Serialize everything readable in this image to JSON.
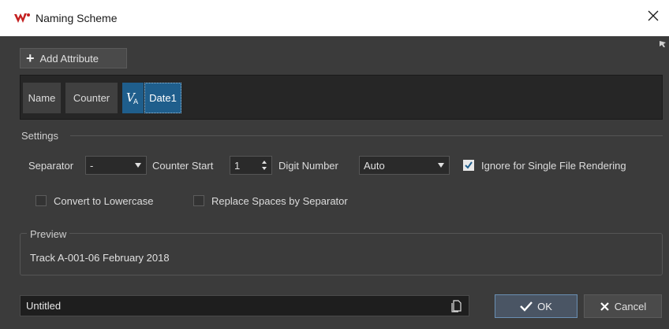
{
  "window": {
    "title": "Naming Scheme"
  },
  "toolbar": {
    "add_attribute_label": "Add Attribute"
  },
  "attributes": [
    {
      "label": "Name"
    },
    {
      "label": "Counter"
    },
    {
      "label": "Date1",
      "selected": true
    }
  ],
  "settings": {
    "group_label": "Settings",
    "separator_label": "Separator",
    "separator_value": "-",
    "counter_start_label": "Counter Start",
    "counter_start_value": "1",
    "digit_number_label": "Digit Number",
    "digit_number_value": "Auto",
    "ignore_single_label": "Ignore for Single File Rendering",
    "ignore_single_checked": true,
    "lowercase_label": "Convert to Lowercase",
    "lowercase_checked": false,
    "replace_spaces_label": "Replace Spaces by Separator",
    "replace_spaces_checked": false
  },
  "preview": {
    "group_label": "Preview",
    "text": "Track A-001-06 February 2018"
  },
  "footer": {
    "name_value": "Untitled",
    "ok_label": "OK",
    "cancel_label": "Cancel"
  },
  "colors": {
    "accent": "#1f5e8c",
    "background": "#3b3b3b",
    "logo": "#c42020"
  }
}
